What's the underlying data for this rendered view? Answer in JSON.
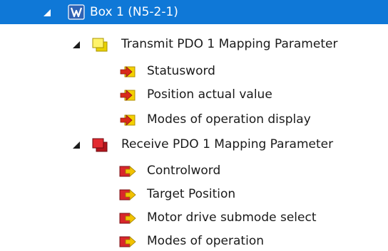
{
  "tree": {
    "root": {
      "label": "Box 1 (N5-2-1)",
      "icon": "device-box-icon",
      "expanded": true,
      "selected": true,
      "selection_color": "#0f78d7"
    },
    "groups": [
      {
        "label": "Transmit PDO 1 Mapping Parameter",
        "icon": "transmit-pdo-icon",
        "icon_color": "#f2e21a",
        "expanded": true,
        "items": [
          {
            "label": "Statusword",
            "icon": "input-variable-icon"
          },
          {
            "label": "Position actual value",
            "icon": "input-variable-icon"
          },
          {
            "label": "Modes of operation display",
            "icon": "input-variable-icon"
          }
        ]
      },
      {
        "label": "Receive PDO 1 Mapping Parameter",
        "icon": "receive-pdo-icon",
        "icon_color": "#d8232a",
        "expanded": true,
        "items": [
          {
            "label": "Controlword",
            "icon": "output-variable-icon"
          },
          {
            "label": "Target Position",
            "icon": "output-variable-icon"
          },
          {
            "label": "Motor drive submode select",
            "icon": "output-variable-icon"
          },
          {
            "label": "Modes of operation",
            "icon": "output-variable-icon"
          }
        ]
      }
    ]
  }
}
